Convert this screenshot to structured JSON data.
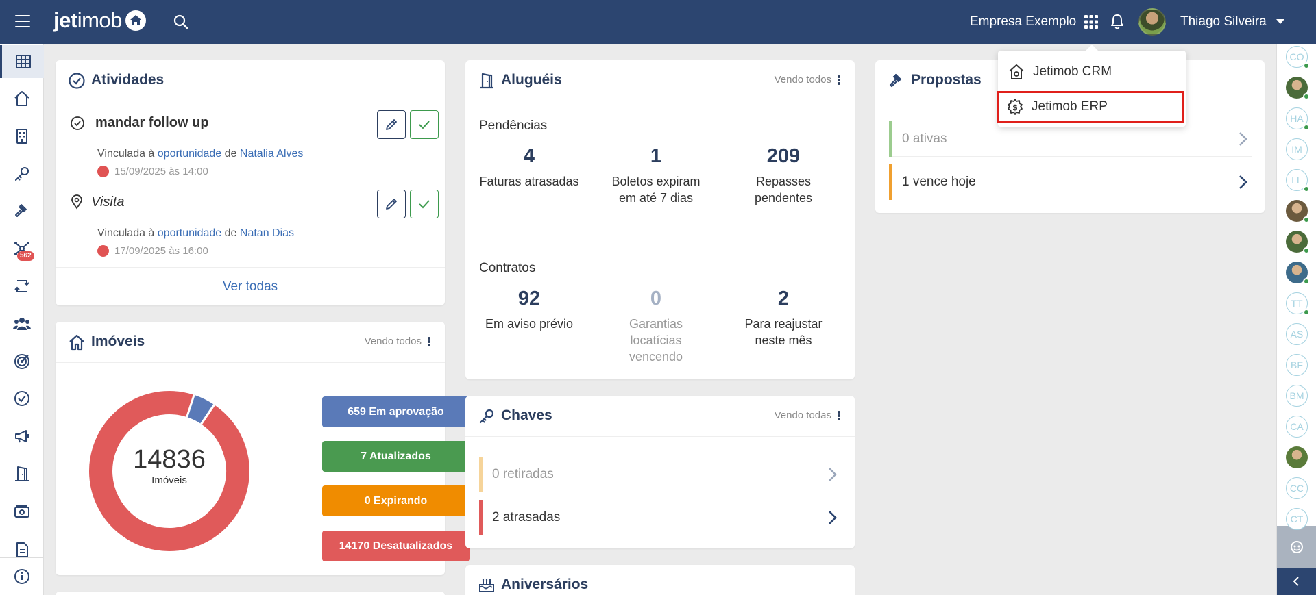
{
  "topbar": {
    "logo_bold": "jet",
    "logo_thin": "imob",
    "company": "Empresa Exemplo",
    "user_name": "Thiago Silveira"
  },
  "sidebar": {
    "badge": "562",
    "items": [
      "dashboard",
      "home",
      "building",
      "key",
      "gavel",
      "network",
      "sync",
      "users",
      "target",
      "check",
      "megaphone",
      "door",
      "money",
      "document",
      "info"
    ]
  },
  "dropdown": {
    "items": [
      {
        "label": "Jetimob CRM",
        "icon": "house-icon"
      },
      {
        "label": "Jetimob ERP",
        "icon": "gear-dollar-icon"
      }
    ]
  },
  "atividades": {
    "title": "Atividades",
    "items": [
      {
        "title": "mandar follow up",
        "prefix": "Vinculada à",
        "link": "oportunidade",
        "mid": "de",
        "person": "Natalia Alves",
        "date": "15/09/2025 às 14:00"
      },
      {
        "title": "Visita",
        "prefix": "Vinculada à",
        "link": "oportunidade",
        "mid": "de",
        "person": "Natan Dias",
        "date": "17/09/2025 às 16:00"
      }
    ],
    "ver_todas": "Ver todas"
  },
  "alugueis": {
    "title": "Aluguéis",
    "vendo": "Vendo todos",
    "pendencias_label": "Pendências",
    "pendencias": [
      {
        "value": "4",
        "desc": "Faturas atrasadas"
      },
      {
        "value": "1",
        "desc": "Boletos expiram em até 7 dias"
      },
      {
        "value": "209",
        "desc": "Repasses pendentes"
      }
    ],
    "contratos_label": "Contratos",
    "contratos": [
      {
        "value": "92",
        "desc": "Em aviso prévio"
      },
      {
        "value": "0",
        "desc": "Garantias locatícias vencendo"
      },
      {
        "value": "2",
        "desc": "Para reajustar neste mês"
      }
    ]
  },
  "propostas": {
    "title": "Propostas",
    "rows": [
      {
        "label": "0 ativas",
        "color": "#9ccc8f"
      },
      {
        "label": "1 vence hoje",
        "color": "#f0a030"
      }
    ]
  },
  "imoveis": {
    "title": "Imóveis",
    "vendo": "Vendo todos",
    "total": "14836",
    "total_label": "Imóveis",
    "legend": [
      {
        "label": "659 Em aprovação",
        "color": "#5a7ab8"
      },
      {
        "label": "7 Atualizados",
        "color": "#4a9a50"
      },
      {
        "label": "0 Expirando",
        "color": "#f08c00"
      },
      {
        "label": "14170 Desatualizados",
        "color": "#e05a5a"
      }
    ]
  },
  "chart_data": {
    "type": "pie",
    "categories": [
      "Em aprovação",
      "Atualizados",
      "Expirando",
      "Desatualizados"
    ],
    "values": [
      659,
      7,
      0,
      14170
    ],
    "colors": [
      "#5a7ab8",
      "#4a9a50",
      "#f08c00",
      "#e05a5a"
    ]
  },
  "chaves": {
    "title": "Chaves",
    "vendo": "Vendo todas",
    "rows": [
      {
        "label": "0 retiradas",
        "color": "#f6d49a"
      },
      {
        "label": "2 atrasadas",
        "color": "#e05a5a"
      }
    ]
  },
  "aniversarios": {
    "title": "Aniversários"
  },
  "rightrail": {
    "people": [
      {
        "initials": "CO",
        "online": true,
        "photo": false
      },
      {
        "initials": "",
        "online": true,
        "photo": true
      },
      {
        "initials": "HA",
        "online": true,
        "photo": false
      },
      {
        "initials": "IM",
        "online": false,
        "photo": false
      },
      {
        "initials": "LL",
        "online": true,
        "photo": false
      },
      {
        "initials": "",
        "online": true,
        "photo": true
      },
      {
        "initials": "",
        "online": true,
        "photo": true
      },
      {
        "initials": "",
        "online": true,
        "photo": true
      },
      {
        "initials": "TT",
        "online": true,
        "photo": false
      },
      {
        "initials": "AS",
        "online": false,
        "photo": false
      },
      {
        "initials": "BF",
        "online": false,
        "photo": false
      },
      {
        "initials": "BM",
        "online": false,
        "photo": false
      },
      {
        "initials": "CA",
        "online": false,
        "photo": false
      },
      {
        "initials": "",
        "online": false,
        "photo": true
      },
      {
        "initials": "CC",
        "online": false,
        "photo": false
      },
      {
        "initials": "CT",
        "online": false,
        "photo": false
      }
    ]
  }
}
